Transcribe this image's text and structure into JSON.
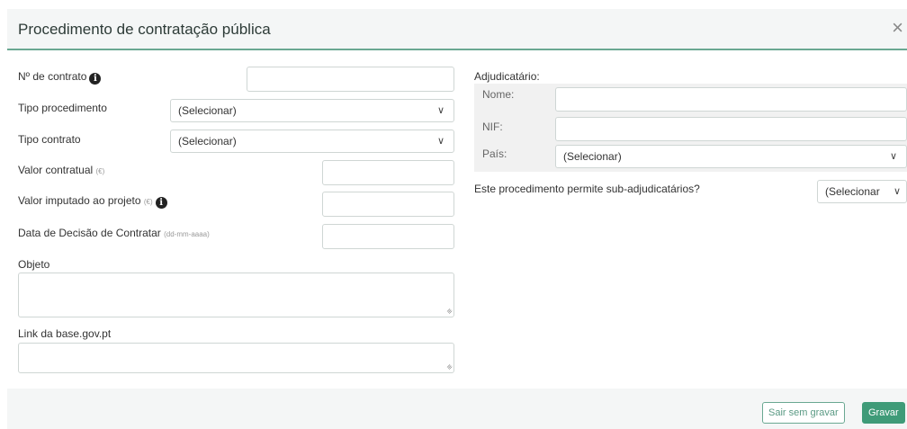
{
  "dialog": {
    "title": "Procedimento de contratação pública",
    "close_icon": "×"
  },
  "left": {
    "contract_number_label": "Nº de contrato",
    "procedure_type_label": "Tipo procedimento",
    "procedure_type_value": "(Selecionar)",
    "contract_type_label": "Tipo contrato",
    "contract_type_value": "(Selecionar)",
    "contract_value_label": "Valor contratual",
    "contract_value_unit": "(€)",
    "imputed_value_label": "Valor imputado ao projeto",
    "imputed_value_unit": "(€)",
    "decision_date_label": "Data de Decisão de Contratar",
    "decision_date_hint": "(dd-mm-aaaa)",
    "object_label": "Objeto",
    "link_label": "Link da base.gov.pt"
  },
  "right": {
    "awardee_label": "Adjudicatário:",
    "name_label": "Nome:",
    "nif_label": "NIF:",
    "country_label": "País:",
    "country_value": "(Selecionar)",
    "subawardee_question": "Este procedimento permite sub-adjudicatários?",
    "subawardee_value": "(Selecionar"
  },
  "footer": {
    "exit_label": "Sair sem gravar",
    "save_label": "Gravar"
  },
  "icons": {
    "info": "i",
    "chevron": "∨",
    "grip": "≡"
  }
}
